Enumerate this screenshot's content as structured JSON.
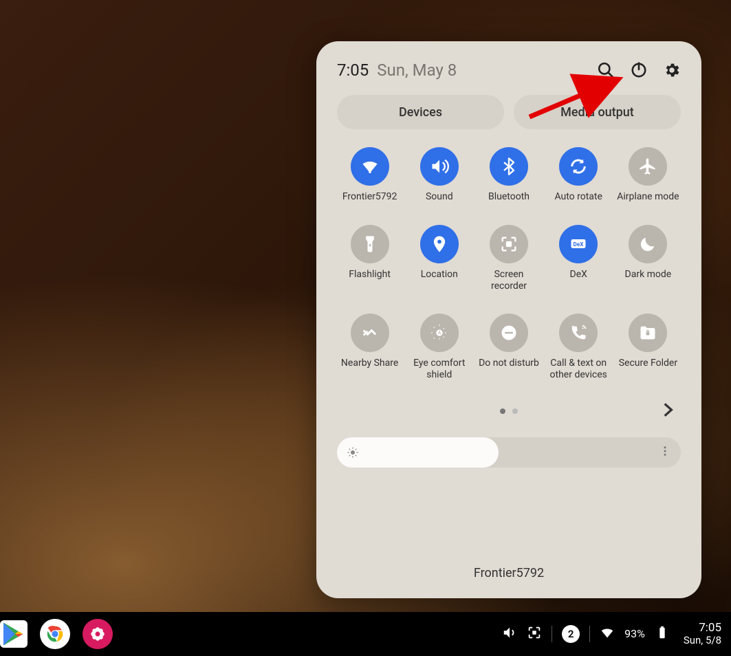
{
  "header": {
    "time": "7:05",
    "date": "Sun, May 8",
    "icons": {
      "search": "search-icon",
      "power": "power-icon",
      "settings": "gear-icon"
    }
  },
  "pills": [
    {
      "label": "Devices",
      "name": "devices-button"
    },
    {
      "label": "Media output",
      "name": "media-output-button"
    }
  ],
  "tiles": [
    {
      "name": "wifi-tile",
      "icon": "wifi",
      "label": "Frontier5792",
      "active": true
    },
    {
      "name": "sound-tile",
      "icon": "sound",
      "label": "Sound",
      "active": true
    },
    {
      "name": "bluetooth-tile",
      "icon": "bluetooth",
      "label": "Bluetooth",
      "active": true
    },
    {
      "name": "auto-rotate-tile",
      "icon": "rotate",
      "label": "Auto rotate",
      "active": true
    },
    {
      "name": "airplane-tile",
      "icon": "airplane",
      "label": "Airplane mode",
      "active": false
    },
    {
      "name": "flashlight-tile",
      "icon": "flashlight",
      "label": "Flashlight",
      "active": false
    },
    {
      "name": "location-tile",
      "icon": "location",
      "label": "Location",
      "active": true
    },
    {
      "name": "screen-recorder-tile",
      "icon": "screenrec",
      "label": "Screen recorder",
      "active": false
    },
    {
      "name": "dex-tile",
      "icon": "dex",
      "label": "DeX",
      "active": true
    },
    {
      "name": "dark-mode-tile",
      "icon": "moon",
      "label": "Dark mode",
      "active": false
    },
    {
      "name": "nearby-share-tile",
      "icon": "nearby",
      "label": "Nearby Share",
      "active": false
    },
    {
      "name": "eye-comfort-tile",
      "icon": "eyecomfort",
      "label": "Eye comfort shield",
      "active": false
    },
    {
      "name": "dnd-tile",
      "icon": "dnd",
      "label": "Do not disturb",
      "active": false
    },
    {
      "name": "call-text-tile",
      "icon": "calltext",
      "label": "Call & text on other devices",
      "active": false
    },
    {
      "name": "secure-folder-tile",
      "icon": "securefolder",
      "label": "Secure Folder",
      "active": false
    }
  ],
  "pager": {
    "pages": 2,
    "current": 0
  },
  "brightness": {
    "percent": 47
  },
  "footer": {
    "network": "Frontier5792"
  },
  "annotation": {
    "points_to": "power-icon"
  },
  "taskbar": {
    "apps": [
      {
        "name": "play-store-app",
        "icon": "play"
      },
      {
        "name": "chrome-app",
        "icon": "chrome"
      },
      {
        "name": "gallery-app",
        "icon": "flower"
      }
    ],
    "status": {
      "volume": "on",
      "screen_capture": "on",
      "notification_count": "2",
      "wifi": "on",
      "battery_percent": "93%",
      "time": "7:05",
      "date": "Sun, 5/8"
    }
  }
}
